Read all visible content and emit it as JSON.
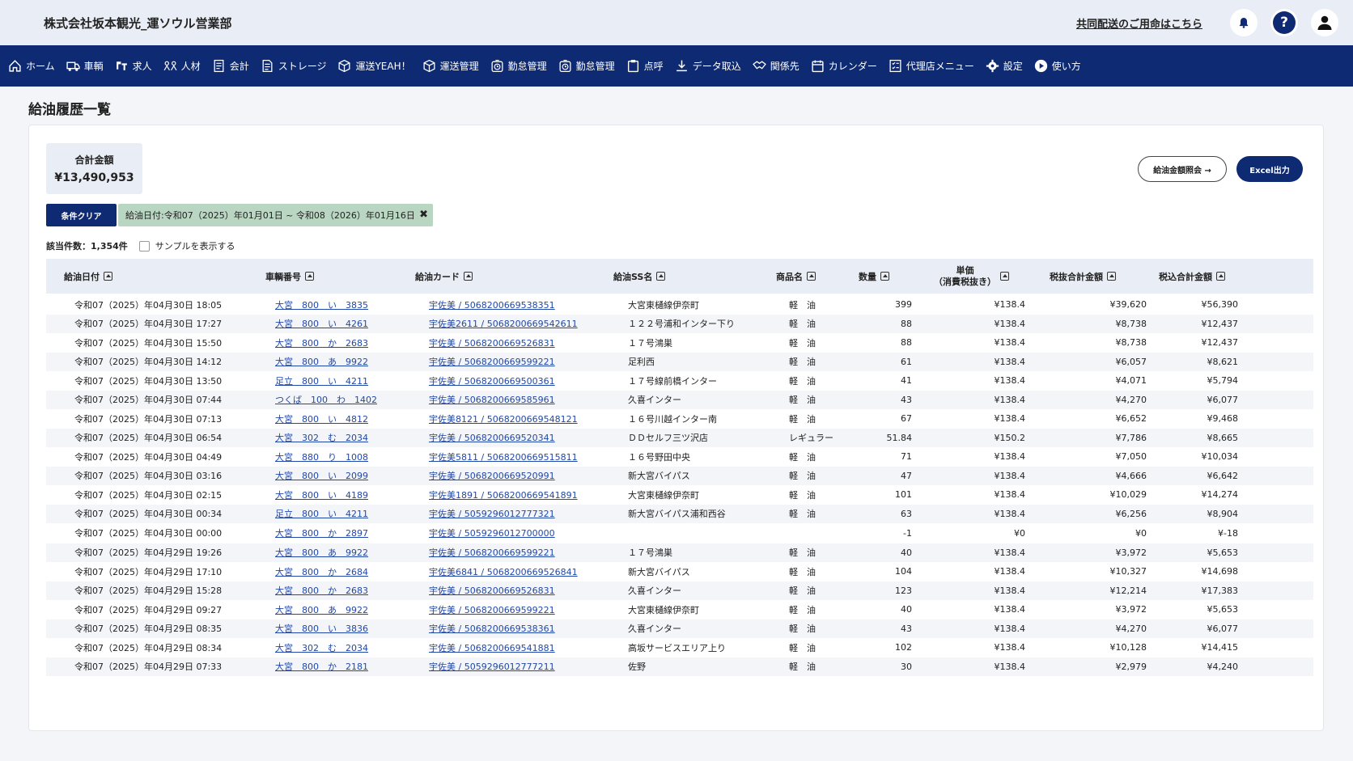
{
  "header": {
    "company": "株式会社坂本観光_運ソウル営業部",
    "kyodo_link": "共同配送のご用命はこちら",
    "help": "?"
  },
  "nav": [
    {
      "label": "ホーム",
      "icon": "home-icon"
    },
    {
      "label": "車輌",
      "icon": "truck-icon"
    },
    {
      "label": "求人",
      "icon": "job-icon"
    },
    {
      "label": "人材",
      "icon": "people-icon"
    },
    {
      "label": "会計",
      "icon": "ledger-icon"
    },
    {
      "label": "ストレージ",
      "icon": "document-icon"
    },
    {
      "label": "運送YEAH！",
      "icon": "box-icon"
    },
    {
      "label": "運送管理",
      "icon": "box-icon"
    },
    {
      "label": "勤怠管理",
      "icon": "timer-icon"
    },
    {
      "label": "勤怠管理",
      "icon": "timer-icon"
    },
    {
      "label": "点呼",
      "icon": "clipboard-icon"
    },
    {
      "label": "データ取込",
      "icon": "download-icon"
    },
    {
      "label": "関係先",
      "icon": "handshake-icon"
    },
    {
      "label": "カレンダー",
      "icon": "calendar-icon"
    },
    {
      "label": "代理店メニュー",
      "icon": "agency-icon"
    },
    {
      "label": "設定",
      "icon": "gear-icon"
    },
    {
      "label": "使い方",
      "icon": "play-icon"
    }
  ],
  "page_title": "給油履歴一覧",
  "summary": {
    "label": "合計金額",
    "value": "¥13,490,953"
  },
  "buttons": {
    "inquiry": "給油金額照会 →",
    "excel": "Excel出力",
    "clear": "条件クリア"
  },
  "filter_chip": "給油日付:令和07（2025）年01月01日 ~ 令和08（2026）年01月16日",
  "count_text": "該当件数：1,354件",
  "sample_label": "サンプルを表示する",
  "columns": [
    "給油日付",
    "車輌番号",
    "給油カード",
    "給油SS名",
    "商品名",
    "数量",
    "単価",
    "（消費税抜き）",
    "税抜合計金額",
    "税込合計金額"
  ],
  "rows": [
    [
      "令和07（2025）年04月30日 18:05",
      "大宮　800　い　3835",
      "宇佐美 / 5068200669538351",
      "大宮東樋線伊奈町",
      "軽　油",
      "399",
      "¥138.4",
      "¥39,620",
      "¥56,390"
    ],
    [
      "令和07（2025）年04月30日 17:27",
      "大宮　800　い　4261",
      "宇佐美2611 / 5068200669542611",
      "１２２号浦和インター下り",
      "軽　油",
      "88",
      "¥138.4",
      "¥8,738",
      "¥12,437"
    ],
    [
      "令和07（2025）年04月30日 15:50",
      "大宮　800　か　2683",
      "宇佐美 / 5068200669526831",
      "１７号鴻巣",
      "軽　油",
      "88",
      "¥138.4",
      "¥8,738",
      "¥12,437"
    ],
    [
      "令和07（2025）年04月30日 14:12",
      "大宮　800　あ　9922",
      "宇佐美 / 5068200669599221",
      "足利西",
      "軽　油",
      "61",
      "¥138.4",
      "¥6,057",
      "¥8,621"
    ],
    [
      "令和07（2025）年04月30日 13:50",
      "足立　800　い　4211",
      "宇佐美 / 5068200669500361",
      "１７号線前橋インター",
      "軽　油",
      "41",
      "¥138.4",
      "¥4,071",
      "¥5,794"
    ],
    [
      "令和07（2025）年04月30日 07:44",
      "つくば　100　わ　1402",
      "宇佐美 / 5068200669585961",
      "久喜インター",
      "軽　油",
      "43",
      "¥138.4",
      "¥4,270",
      "¥6,077"
    ],
    [
      "令和07（2025）年04月30日 07:13",
      "大宮　800　い　4812",
      "宇佐美8121 / 5068200669548121",
      "１６号川越インター南",
      "軽　油",
      "67",
      "¥138.4",
      "¥6,652",
      "¥9,468"
    ],
    [
      "令和07（2025）年04月30日 06:54",
      "大宮　302　む　2034",
      "宇佐美 / 5068200669520341",
      "ＤＤセルフ三ツ沢店",
      "レギュラー",
      "51.84",
      "¥150.2",
      "¥7,786",
      "¥8,665"
    ],
    [
      "令和07（2025）年04月30日 04:49",
      "大宮　880　り　1008",
      "宇佐美5811 / 5068200669515811",
      "１６号野田中央",
      "軽　油",
      "71",
      "¥138.4",
      "¥7,050",
      "¥10,034"
    ],
    [
      "令和07（2025）年04月30日 03:16",
      "大宮　800　い　2099",
      "宇佐美 / 5068200669520991",
      "新大宮バイパス",
      "軽　油",
      "47",
      "¥138.4",
      "¥4,666",
      "¥6,642"
    ],
    [
      "令和07（2025）年04月30日 02:15",
      "大宮　800　い　4189",
      "宇佐美1891 / 5068200669541891",
      "大宮東樋線伊奈町",
      "軽　油",
      "101",
      "¥138.4",
      "¥10,029",
      "¥14,274"
    ],
    [
      "令和07（2025）年04月30日 00:34",
      "足立　800　い　4211",
      "宇佐美 / 5059296012777321",
      "新大宮バイパス浦和西谷",
      "軽　油",
      "63",
      "¥138.4",
      "¥6,256",
      "¥8,904"
    ],
    [
      "令和07（2025）年04月30日 00:00",
      "大宮　800　か　2897",
      "宇佐美 / 5059296012700000",
      "",
      "",
      "-1",
      "¥0",
      "¥0",
      "¥-18"
    ],
    [
      "令和07（2025）年04月29日 19:26",
      "大宮　800　あ　9922",
      "宇佐美 / 5068200669599221",
      "１７号鴻巣",
      "軽　油",
      "40",
      "¥138.4",
      "¥3,972",
      "¥5,653"
    ],
    [
      "令和07（2025）年04月29日 17:10",
      "大宮　800　か　2684",
      "宇佐美6841 / 5068200669526841",
      "新大宮バイパス",
      "軽　油",
      "104",
      "¥138.4",
      "¥10,327",
      "¥14,698"
    ],
    [
      "令和07（2025）年04月29日 15:28",
      "大宮　800　か　2683",
      "宇佐美 / 5068200669526831",
      "久喜インター",
      "軽　油",
      "123",
      "¥138.4",
      "¥12,214",
      "¥17,383"
    ],
    [
      "令和07（2025）年04月29日 09:27",
      "大宮　800　あ　9922",
      "宇佐美 / 5068200669599221",
      "大宮東樋線伊奈町",
      "軽　油",
      "40",
      "¥138.4",
      "¥3,972",
      "¥5,653"
    ],
    [
      "令和07（2025）年04月29日 08:35",
      "大宮　800　い　3836",
      "宇佐美 / 5068200669538361",
      "久喜インター",
      "軽　油",
      "43",
      "¥138.4",
      "¥4,270",
      "¥6,077"
    ],
    [
      "令和07（2025）年04月29日 08:34",
      "大宮　302　む　2034",
      "宇佐美 / 5068200669541881",
      "高坂サービスエリア上り",
      "軽　油",
      "102",
      "¥138.4",
      "¥10,128",
      "¥14,415"
    ],
    [
      "令和07（2025）年04月29日 07:33",
      "大宮　800　か　2181",
      "宇佐美 / 5059296012777211",
      "佐野",
      "軽　油",
      "30",
      "¥138.4",
      "¥2,979",
      "¥4,240"
    ]
  ]
}
